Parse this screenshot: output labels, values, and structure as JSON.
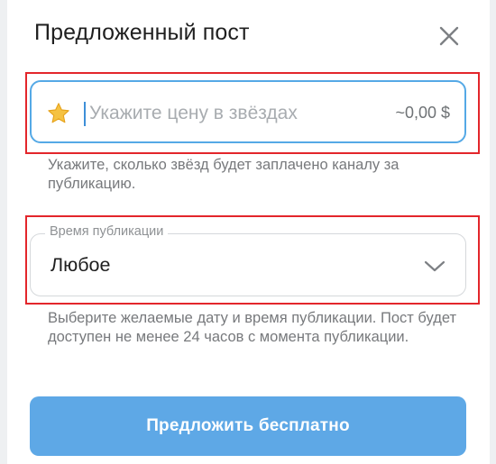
{
  "dialog": {
    "title": "Предложенный пост",
    "close_icon": "close-icon"
  },
  "price": {
    "placeholder": "Укажите цену в звёздах",
    "value": "",
    "usd_estimate": "~0,00 $",
    "icon": "star-icon",
    "hint": "Укажите, сколько звёзд будет заплачено каналу за публикацию."
  },
  "publish_time": {
    "label": "Время публикации",
    "value": "Любое",
    "icon": "chevron-down-icon",
    "hint": "Выберите желаемые дату и время публикации. Пост будет доступен не менее 24 часов с момента публикации."
  },
  "submit": {
    "label": "Предложить бесплатно"
  },
  "colors": {
    "accent": "#5ea8e6",
    "focus_border": "#55a9e6",
    "annotation_red": "#e3262b",
    "star": "#f5c242"
  }
}
